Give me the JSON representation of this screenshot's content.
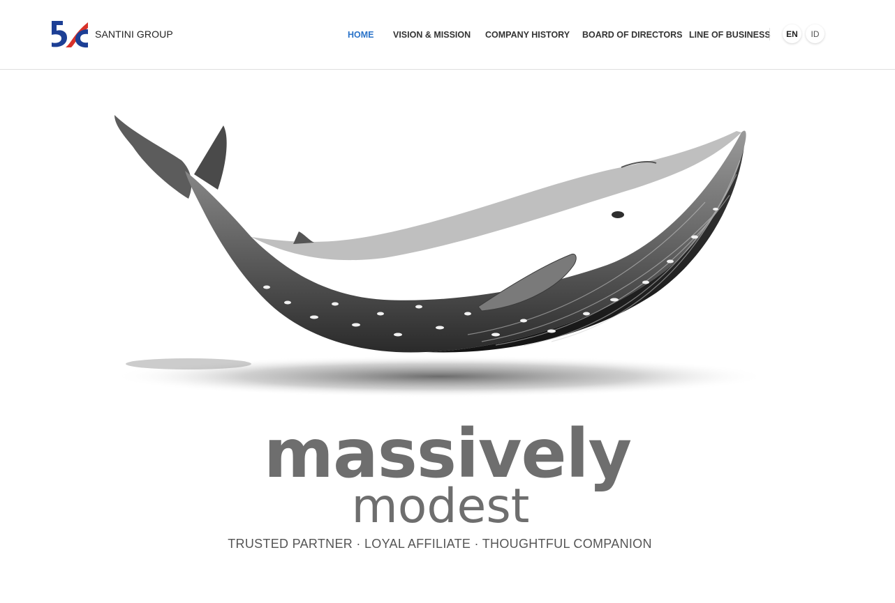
{
  "header": {
    "brand_name": "SANTINI GROUP",
    "logo_colors": {
      "blue": "#1c3f95",
      "red": "#d8322a"
    }
  },
  "nav": {
    "items": [
      {
        "label": "HOME",
        "active": true
      },
      {
        "label": "VISION & MISSION",
        "active": false
      },
      {
        "label": "COMPANY HISTORY",
        "active": false
      },
      {
        "label": "BOARD OF DIRECTORS",
        "active": false
      },
      {
        "label": "LINE OF BUSINESS",
        "active": false
      }
    ],
    "active_color": "#2a73c9"
  },
  "languages": [
    {
      "label": "EN",
      "active": true
    },
    {
      "label": "ID",
      "active": false
    }
  ],
  "hero": {
    "image": "whale-illustration",
    "headline_main": "massively",
    "headline_sub": "modest",
    "tagline": "TRUSTED PARTNER · LOYAL AFFILIATE · THOUGHTFUL COMPANION"
  }
}
